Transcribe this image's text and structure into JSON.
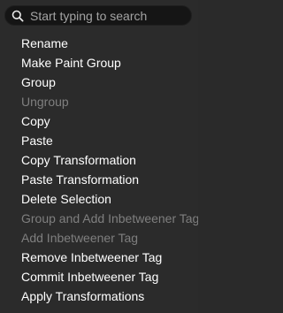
{
  "search": {
    "placeholder": "Start typing to search",
    "value": ""
  },
  "menu": {
    "items": [
      {
        "label": "Rename",
        "enabled": true
      },
      {
        "label": "Make Paint Group",
        "enabled": true
      },
      {
        "label": "Group",
        "enabled": true
      },
      {
        "label": "Ungroup",
        "enabled": false
      },
      {
        "label": "Copy",
        "enabled": true
      },
      {
        "label": "Paste",
        "enabled": true
      },
      {
        "label": "Copy Transformation",
        "enabled": true
      },
      {
        "label": "Paste Transformation",
        "enabled": true
      },
      {
        "label": "Delete Selection",
        "enabled": true
      },
      {
        "label": "Group and Add Inbetweener Tag",
        "enabled": false
      },
      {
        "label": "Add Inbetweener Tag",
        "enabled": false
      },
      {
        "label": "Remove Inbetweener Tag",
        "enabled": true
      },
      {
        "label": "Commit Inbetweener Tag",
        "enabled": true
      },
      {
        "label": "Apply Transformations",
        "enabled": true
      }
    ]
  },
  "colors": {
    "background": "#2b2b2b",
    "search_background": "#151515",
    "text": "#ffffff",
    "disabled_text": "#7f7f7f",
    "placeholder_text": "#a3a3a3"
  },
  "icons": {
    "search": "search-icon"
  }
}
